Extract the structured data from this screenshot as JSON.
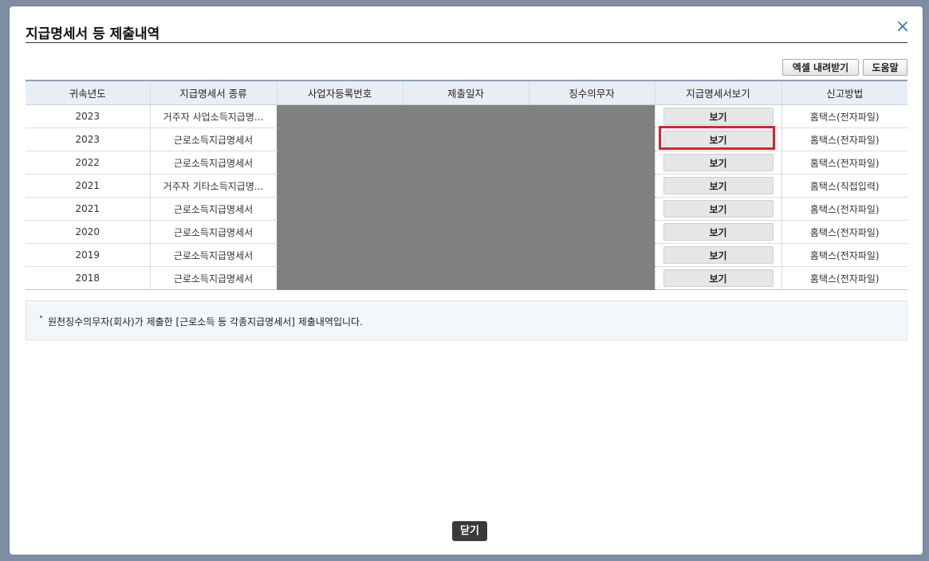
{
  "dialog": {
    "title": "지급명세서 등 제출내역",
    "close_icon": "×"
  },
  "toolbar": {
    "excel_label": "엑셀 내려받기",
    "help_label": "도움말"
  },
  "table": {
    "headers": [
      "귀속년도",
      "지급명세서 종류",
      "사업자등록번호",
      "제출일자",
      "징수의무자",
      "지급명세서보기",
      "신고방법"
    ],
    "rows": [
      {
        "year": "2023",
        "kind": "거주자 사업소득지급명...",
        "view": "보기",
        "method": "홈택스(전자파일)"
      },
      {
        "year": "2023",
        "kind": "근로소득지급명세서",
        "view": "보기",
        "method": "홈택스(전자파일)"
      },
      {
        "year": "2022",
        "kind": "근로소득지급명세서",
        "view": "보기",
        "method": "홈택스(전자파일)"
      },
      {
        "year": "2021",
        "kind": "거주자 기타소득지급명...",
        "view": "보기",
        "method": "홈택스(직접입력)"
      },
      {
        "year": "2021",
        "kind": "근로소득지급명세서",
        "view": "보기",
        "method": "홈택스(전자파일)"
      },
      {
        "year": "2020",
        "kind": "근로소득지급명세서",
        "view": "보기",
        "method": "홈택스(전자파일)"
      },
      {
        "year": "2019",
        "kind": "근로소득지급명세서",
        "view": "보기",
        "method": "홈택스(전자파일)"
      },
      {
        "year": "2018",
        "kind": "근로소득지급명세서",
        "view": "보기",
        "method": "홈택스(전자파일)"
      }
    ]
  },
  "info": {
    "text": "원천징수의무자(회사)가 제출한 [근로소득 등 각종지급명세서] 제출내역입니다."
  },
  "footer": {
    "close_label": "닫기"
  },
  "colors": {
    "accent": "#3a7bd5",
    "highlight": "#e0202a",
    "mask": "#808080"
  }
}
